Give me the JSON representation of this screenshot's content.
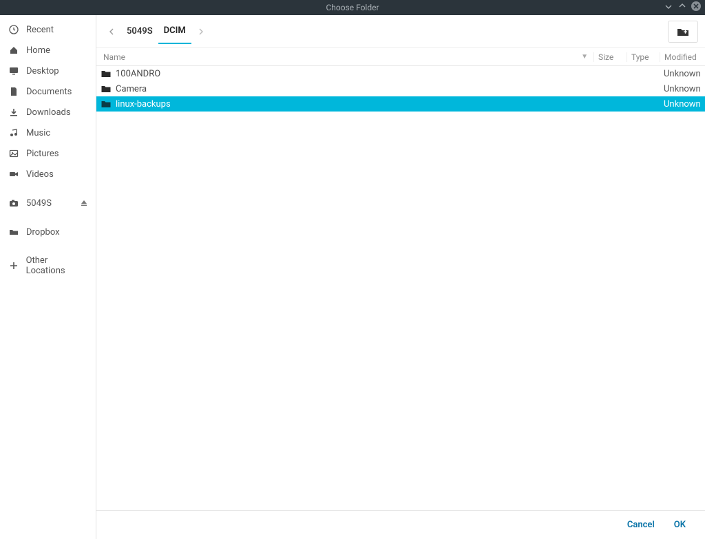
{
  "window": {
    "title": "Choose Folder"
  },
  "sidebar": {
    "items": [
      {
        "label": "Recent",
        "icon": "clock"
      },
      {
        "label": "Home",
        "icon": "home"
      },
      {
        "label": "Desktop",
        "icon": "desktop"
      },
      {
        "label": "Documents",
        "icon": "document"
      },
      {
        "label": "Downloads",
        "icon": "download"
      },
      {
        "label": "Music",
        "icon": "music"
      },
      {
        "label": "Pictures",
        "icon": "picture"
      },
      {
        "label": "Videos",
        "icon": "video"
      }
    ],
    "devices": [
      {
        "label": "5049S",
        "icon": "camera",
        "eject": true
      }
    ],
    "bookmarks": [
      {
        "label": "Dropbox",
        "icon": "folder"
      }
    ],
    "other": {
      "label": "Other Locations",
      "icon": "plus"
    }
  },
  "breadcrumb": {
    "items": [
      "5049S",
      "DCIM"
    ],
    "active_index": 1
  },
  "columns": {
    "name": "Name",
    "size": "Size",
    "type": "Type",
    "modified": "Modified"
  },
  "rows": [
    {
      "name": "100ANDRO",
      "modified": "Unknown",
      "selected": false
    },
    {
      "name": "Camera",
      "modified": "Unknown",
      "selected": false
    },
    {
      "name": "linux-backups",
      "modified": "Unknown",
      "selected": true
    }
  ],
  "footer": {
    "cancel": "Cancel",
    "ok": "OK"
  }
}
